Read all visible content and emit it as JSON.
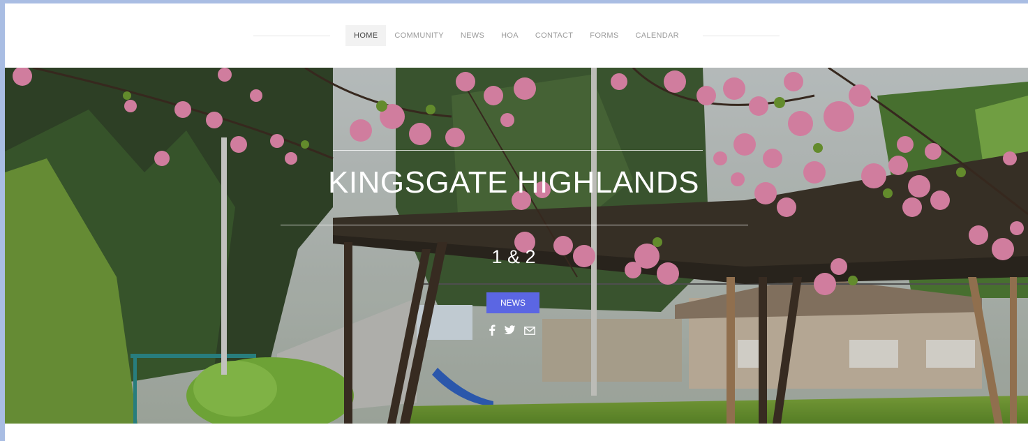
{
  "nav": {
    "items": [
      {
        "label": "HOME",
        "active": true
      },
      {
        "label": "COMMUNITY",
        "active": false
      },
      {
        "label": "NEWS",
        "active": false
      },
      {
        "label": "HOA",
        "active": false
      },
      {
        "label": "CONTACT",
        "active": false
      },
      {
        "label": "FORMS",
        "active": false
      },
      {
        "label": "CALENDAR",
        "active": false
      }
    ]
  },
  "hero": {
    "title": "KINGSGATE HIGHLANDS",
    "subtitle": "1 & 2",
    "button_label": "NEWS",
    "social_icons": [
      "facebook-icon",
      "twitter-icon",
      "email-icon"
    ]
  },
  "colors": {
    "frame": "#a9bde3",
    "button": "#5b66e3",
    "text_light": "#ffffff",
    "nav_text": "#9a9a9a"
  }
}
